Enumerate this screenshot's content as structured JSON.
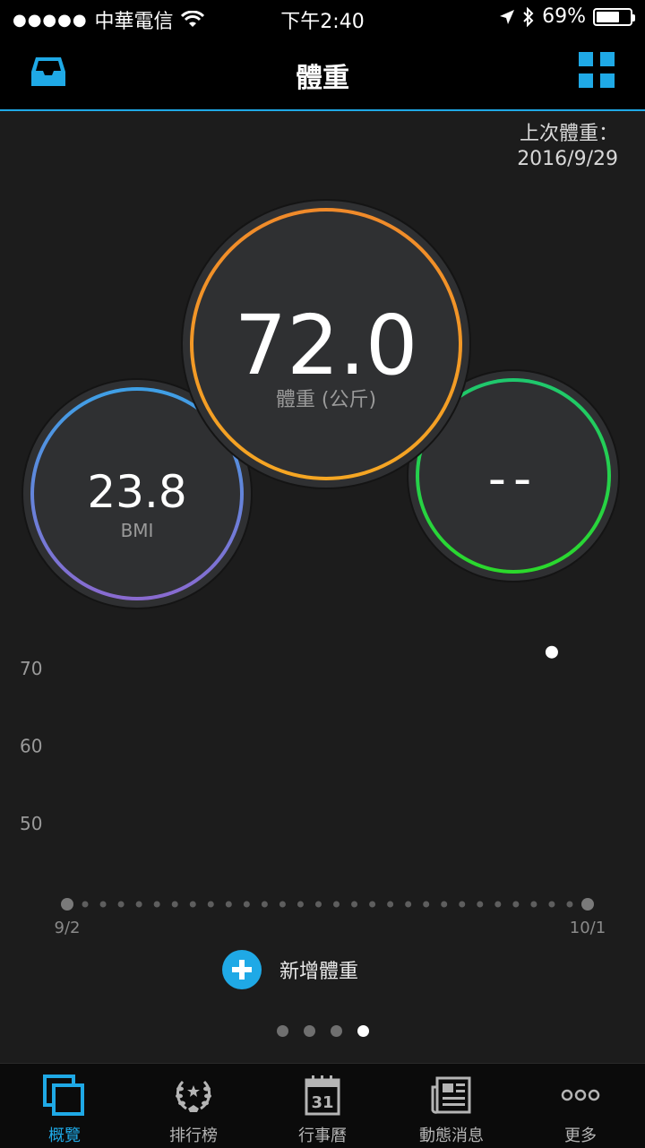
{
  "status_bar": {
    "signal": "●●●●●",
    "carrier": "中華電信",
    "time": "下午2:40",
    "battery_percent": "69%",
    "battery_level": 0.69,
    "icons": [
      "wifi-icon",
      "location-arrow-icon",
      "bluetooth-icon",
      "battery-icon"
    ]
  },
  "header": {
    "title": "體重",
    "left_icon": "inbox-icon",
    "right_icon": "grid-icon",
    "accent_color": "#1fa9e6"
  },
  "last_weight": {
    "label": "上次體重：",
    "date": "2016/9/29"
  },
  "metrics": {
    "weight": {
      "value": "72.0",
      "caption": "體重 (公斤)",
      "ring_color": "#f08a2a"
    },
    "bmi": {
      "value": "23.8",
      "caption": "BMI",
      "ring_color": "#3ea0e6"
    },
    "body_fat": {
      "value": "--",
      "ring_color": "#2bd92b"
    }
  },
  "chart_data": {
    "type": "scatter",
    "y_ticks": [
      "70",
      "60",
      "50"
    ],
    "x_start_label": "9/2",
    "x_end_label": "10/1",
    "points": [
      {
        "x": "9/29",
        "y": 72.0
      }
    ]
  },
  "add_action": {
    "label": "新增體重"
  },
  "pager": {
    "count": 4,
    "active_index": 3
  },
  "tabs": [
    {
      "label": "概覽",
      "icon": "overview-icon",
      "active": true
    },
    {
      "label": "排行榜",
      "icon": "laurel-icon",
      "active": false
    },
    {
      "label": "行事曆",
      "icon": "calendar-icon",
      "active": false
    },
    {
      "label": "動態消息",
      "icon": "news-icon",
      "active": false
    },
    {
      "label": "更多",
      "icon": "more-icon",
      "active": false
    }
  ],
  "calendar_day": "31"
}
